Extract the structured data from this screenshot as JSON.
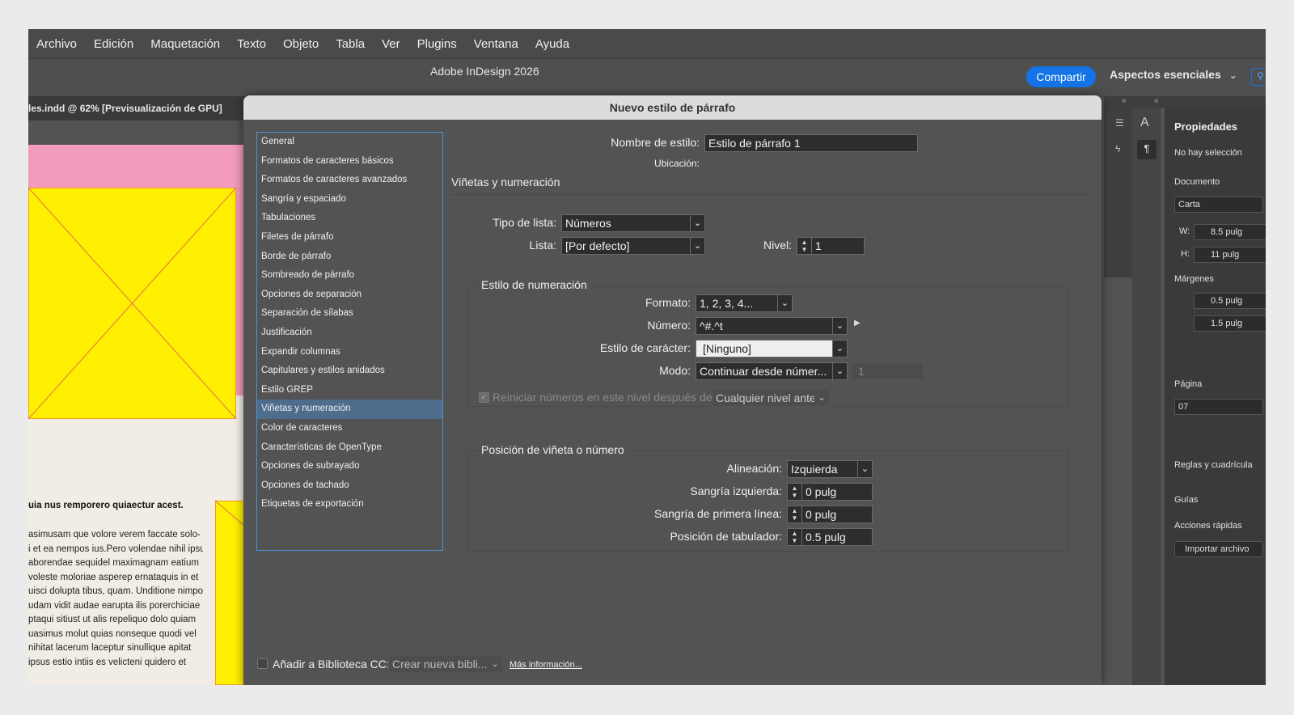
{
  "menu": [
    "Archivo",
    "Edición",
    "Maquetación",
    "Texto",
    "Objeto",
    "Tabla",
    "Ver",
    "Plugins",
    "Ventana",
    "Ayuda"
  ],
  "app_title": "Adobe InDesign 2026",
  "share_label": "Compartir",
  "workspace_label": "Aspectos esenciales",
  "doc_tab": "les.indd @ 62% [Previsualización de GPU]",
  "canvas": {
    "heading": "uia nus remporero quiaectur acest.",
    "body": [
      "asimusam que volore verem faccate solo-",
      "i et ea nempos ius.Pero volendae nihil ipsus",
      "aborendae sequidel maximagnam eatium",
      "voleste moloriae asperep ernataquis in et",
      "uisci dolupta tibus, quam. Unditione nimpos",
      "udam vidit audae earupta ilis porerchiciae",
      "ptaqui sitiust ut alis repeliquo dolo quiam",
      "uasimus molut quias nonseque quodi vel",
      "nihitat lacerum laceptur sinullique apitat",
      "ipsus estio intiis es velicteni quidero et"
    ]
  },
  "properties": {
    "title": "Propiedades",
    "no_selection": "No hay selección",
    "document": "Documento",
    "preset": "Carta",
    "w_label": "W:",
    "w": "8.5 pulg",
    "h_label": "H:",
    "h": "11 pulg",
    "margins": "Márgenes",
    "m1": "0.5 pulg",
    "m2": "1.5 pulg",
    "page": "Página",
    "page_value": "07",
    "rulers": "Reglas y cuadrícula",
    "guides": "Guías",
    "quick_actions": "Acciones rápidas",
    "import_btn": "Importar archivo"
  },
  "dialog": {
    "title": "Nuevo estilo de párrafo",
    "categories": [
      "General",
      "Formatos de caracteres básicos",
      "Formatos de caracteres avanzados",
      "Sangría y espaciado",
      "Tabulaciones",
      "Filetes de párrafo",
      "Borde de párrafo",
      "Sombreado de párrafo",
      "Opciones de separación",
      "Separación de sílabas",
      "Justificación",
      "Expandir columnas",
      "Capitulares y estilos anidados",
      "Estilo GREP",
      "Viñetas y numeración",
      "Color de caracteres",
      "Características de OpenType",
      "Opciones de subrayado",
      "Opciones de tachado",
      "Etiquetas de exportación"
    ],
    "selected_category": "Viñetas y numeración",
    "style_name_label": "Nombre de estilo:",
    "style_name": "Estilo de párrafo 1",
    "location_label": "Ubicación:",
    "section_title": "Viñetas y numeración",
    "list_type_label": "Tipo de lista:",
    "list_type": "Números",
    "list_label": "Lista:",
    "list": "[Por defecto]",
    "level_label": "Nivel:",
    "level": "1",
    "numbering_style": {
      "title": "Estilo de numeración",
      "format_label": "Formato:",
      "format": "1, 2, 3, 4...",
      "number_label": "Número:",
      "number": "^#.^t",
      "char_style_label": "Estilo de carácter:",
      "char_style": "[Ninguno]",
      "mode_label": "Modo:",
      "mode": "Continuar desde númer...",
      "mode_value": "1",
      "restart_label": "Reiniciar números en este nivel después de:",
      "restart_value": "Cualquier nivel ante"
    },
    "position": {
      "title": "Posición de viñeta o número",
      "alignment_label": "Alineación:",
      "alignment": "Izquierda",
      "left_indent_label": "Sangría izquierda:",
      "left_indent": "0 pulg",
      "first_line_label": "Sangría de primera línea:",
      "first_line": "0 pulg",
      "tab_pos_label": "Posición de tabulador:",
      "tab_pos": "0.5 pulg"
    },
    "cc_label": "Añadir a Biblioteca CC:",
    "cc_value": "Crear nueva bibli...",
    "more_info": "Más información..."
  }
}
